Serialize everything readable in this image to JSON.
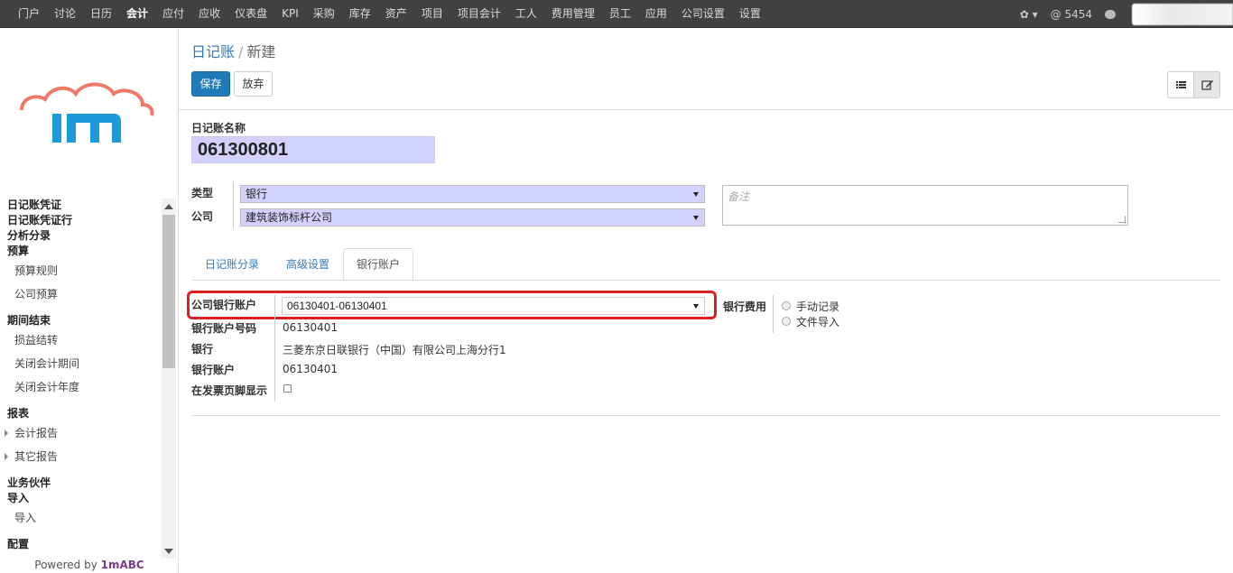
{
  "topnav": {
    "items": [
      "门户",
      "讨论",
      "日历",
      "会计",
      "应付",
      "应收",
      "仪表盘",
      "KPI",
      "采购",
      "库存",
      "资产",
      "项目",
      "项目会计",
      "工人",
      "费用管理",
      "员工",
      "应用",
      "公司设置",
      "设置"
    ],
    "active_index": 3,
    "gear_label": "✿ ▾",
    "messages": "@ 5454"
  },
  "sidebar": {
    "sections": [
      {
        "type": "h",
        "label": "日记账凭证"
      },
      {
        "type": "h",
        "label": "日记账凭证行"
      },
      {
        "type": "h",
        "label": "分析分录"
      },
      {
        "type": "h",
        "label": "预算"
      },
      {
        "type": "i",
        "label": "预算规则"
      },
      {
        "type": "i",
        "label": "公司预算"
      },
      {
        "type": "h",
        "label": "期间结束"
      },
      {
        "type": "i",
        "label": "损益结转"
      },
      {
        "type": "i",
        "label": "关闭会计期间"
      },
      {
        "type": "i",
        "label": "关闭会计年度"
      },
      {
        "type": "h",
        "label": "报表"
      },
      {
        "type": "ic",
        "label": "会计报告"
      },
      {
        "type": "ic",
        "label": "其它报告"
      },
      {
        "type": "h",
        "label": "业务伙伴"
      },
      {
        "type": "h",
        "label": "导入"
      },
      {
        "type": "i",
        "label": "导入"
      },
      {
        "type": "h",
        "label": "配置"
      }
    ],
    "powered_prefix": "Powered by ",
    "powered_brand": "1mABC"
  },
  "breadcrumb": {
    "parent": "日记账",
    "sep": "/",
    "current": "新建"
  },
  "buttons": {
    "save": "保存",
    "discard": "放弃"
  },
  "form": {
    "name_label": "日记账名称",
    "name_value": "061300801",
    "type_label": "类型",
    "type_value": "银行",
    "company_label": "公司",
    "company_value": "建筑装饰标杆公司",
    "note_placeholder": "备注"
  },
  "tabs": [
    "日记账分录",
    "高级设置",
    "银行账户"
  ],
  "bank": {
    "account_label": "公司银行账户",
    "account_value": "06130401-06130401",
    "acc_no_label": "银行账户号码",
    "acc_no_value": "06130401",
    "bank_label": "银行",
    "bank_value": "三菱东京日联银行（中国）有限公司上海分行1",
    "bank_acc_label": "银行账户",
    "bank_acc_value": "06130401",
    "footer_label": "在发票页脚显示",
    "fee_label": "银行费用",
    "fee_options": [
      "手动记录",
      "文件导入"
    ]
  }
}
